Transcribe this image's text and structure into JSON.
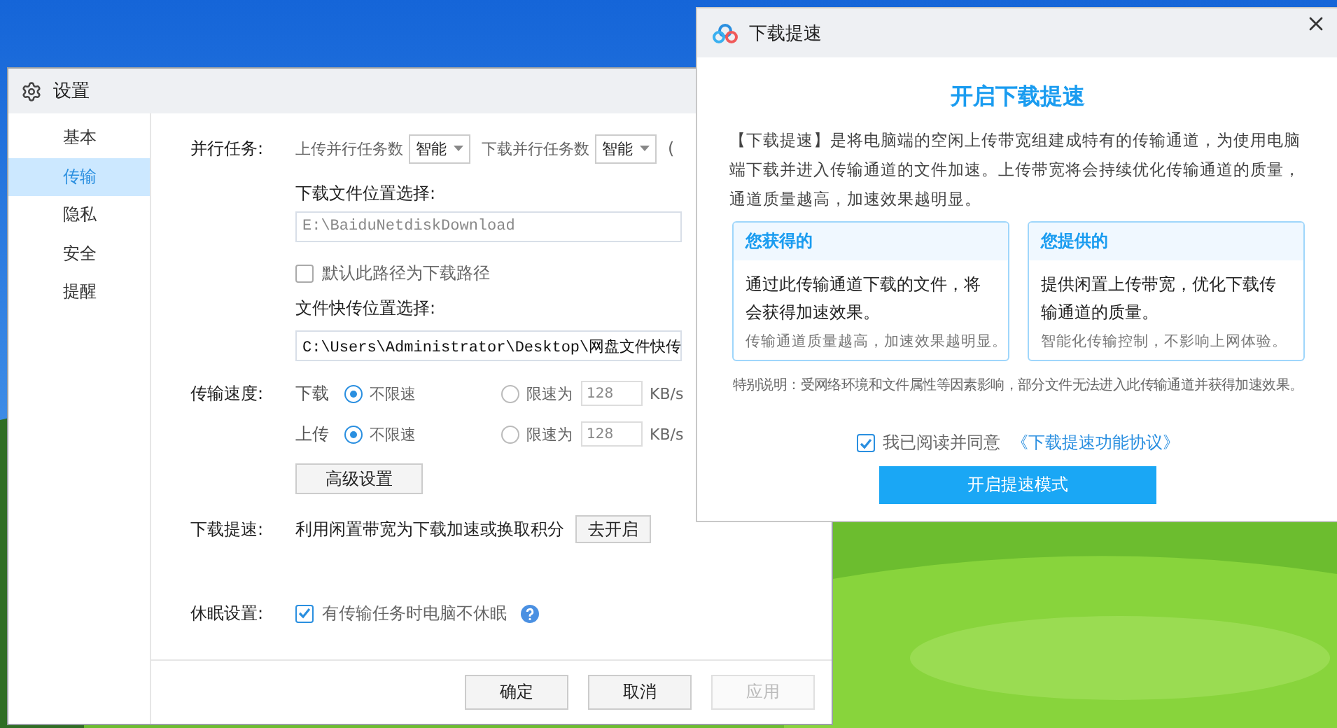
{
  "settings": {
    "title": "设置",
    "nav": [
      {
        "label": "基本",
        "selected": false
      },
      {
        "label": "传输",
        "selected": true
      },
      {
        "label": "隐私",
        "selected": false
      },
      {
        "label": "安全",
        "selected": false
      },
      {
        "label": "提醒",
        "selected": false
      }
    ],
    "parallel": {
      "label": "并行任务:",
      "upload_label": "上传并行任务数",
      "upload_value": "智能",
      "download_label": "下载并行任务数",
      "download_value": "智能",
      "note": "("
    },
    "download_location": {
      "label": "下载文件位置选择:",
      "value": "E:\\BaiduNetdiskDownload",
      "disabled": true
    },
    "default_path": {
      "label": "默认此路径为下载路径",
      "checked": false
    },
    "quick_location": {
      "label": "文件快传位置选择:",
      "value": "C:\\Users\\Administrator\\Desktop\\网盘文件快传"
    },
    "speed": {
      "label": "传输速度:",
      "rows": [
        {
          "direction": "下载",
          "options": [
            {
              "label": "不限速",
              "selected": true
            },
            {
              "label": "限速为",
              "selected": false
            }
          ],
          "limit_value": "128",
          "unit": "KB/s"
        },
        {
          "direction": "上传",
          "options": [
            {
              "label": "不限速",
              "selected": true
            },
            {
              "label": "限速为",
              "selected": false
            }
          ],
          "limit_value": "128",
          "unit": "KB/s"
        }
      ]
    },
    "advanced_button": "高级设置",
    "boost": {
      "label": "下载提速:",
      "text": "利用闲置带宽为下载加速或换取积分",
      "button": "去开启"
    },
    "sleep": {
      "label": "休眠设置:",
      "option": "有传输任务时电脑不休眠",
      "checked": true
    },
    "buttons": [
      {
        "label": "确定",
        "disabled": false
      },
      {
        "label": "取消",
        "disabled": false
      },
      {
        "label": "应用",
        "disabled": true
      }
    ]
  },
  "dialog": {
    "title": "下载提速",
    "heading": "开启下载提速",
    "intro": "【下载提速】是将电脑端的空闲上传带宽组建成特有的传输通道，为使用电脑端下载并进入传输通道的文件加速。上传带宽将会持续优化传输通道的质量，通道质量越高，加速效果越明显。",
    "cards": [
      {
        "title": "您获得的",
        "body": "通过此传输通道下载的文件，将会获得加速效果。",
        "note": "传输通道质量越高，加速效果越明显。"
      },
      {
        "title": "您提供的",
        "body": "提供闲置上传带宽，优化下载传输通道的质量。",
        "note": "智能化传输控制，不影响上网体验。"
      }
    ],
    "notice": "特别说明：受网络环境和文件属性等因素影响，部分文件无法进入此传输通道并获得加速效果。",
    "agree": {
      "checked": true,
      "text": "我已阅读并同意",
      "link": "《下载提速功能协议》"
    },
    "button": "开启提速模式"
  }
}
